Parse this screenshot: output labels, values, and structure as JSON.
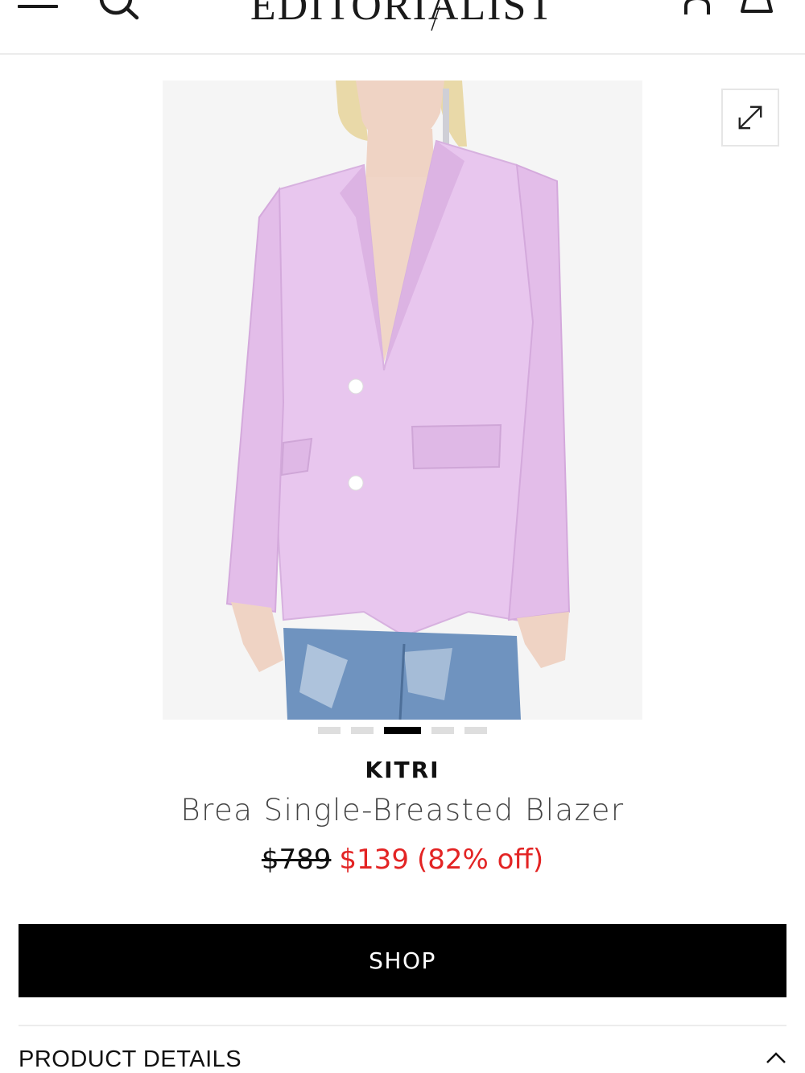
{
  "header": {
    "logo_text": "EDITORIALIST",
    "menu_icon": "hamburger-menu-icon",
    "search_icon": "search-icon",
    "account_icon": "user-icon",
    "bag_icon": "shopping-bag-icon"
  },
  "product": {
    "brand": "KITRI",
    "name": "Brea Single-Breasted Blazer",
    "price_original": "$789",
    "price_sale": "$139",
    "discount": "(82% off)",
    "image_alt": "Lilac single-breasted blazer worn with light-wash jeans",
    "colors": {
      "blazer": "#e8c6ee",
      "blazer_shadow": "#d4a9dc",
      "jeans": "#6f93bf",
      "skin": "#efd3c4",
      "sale_red": "#e32424"
    }
  },
  "carousel": {
    "total": 5,
    "active_index": 2
  },
  "actions": {
    "shop_label": "SHOP",
    "expand_icon": "expand-icon"
  },
  "details": {
    "label": "PRODUCT DETAILS",
    "toggle_icon": "chevron-up-icon"
  }
}
